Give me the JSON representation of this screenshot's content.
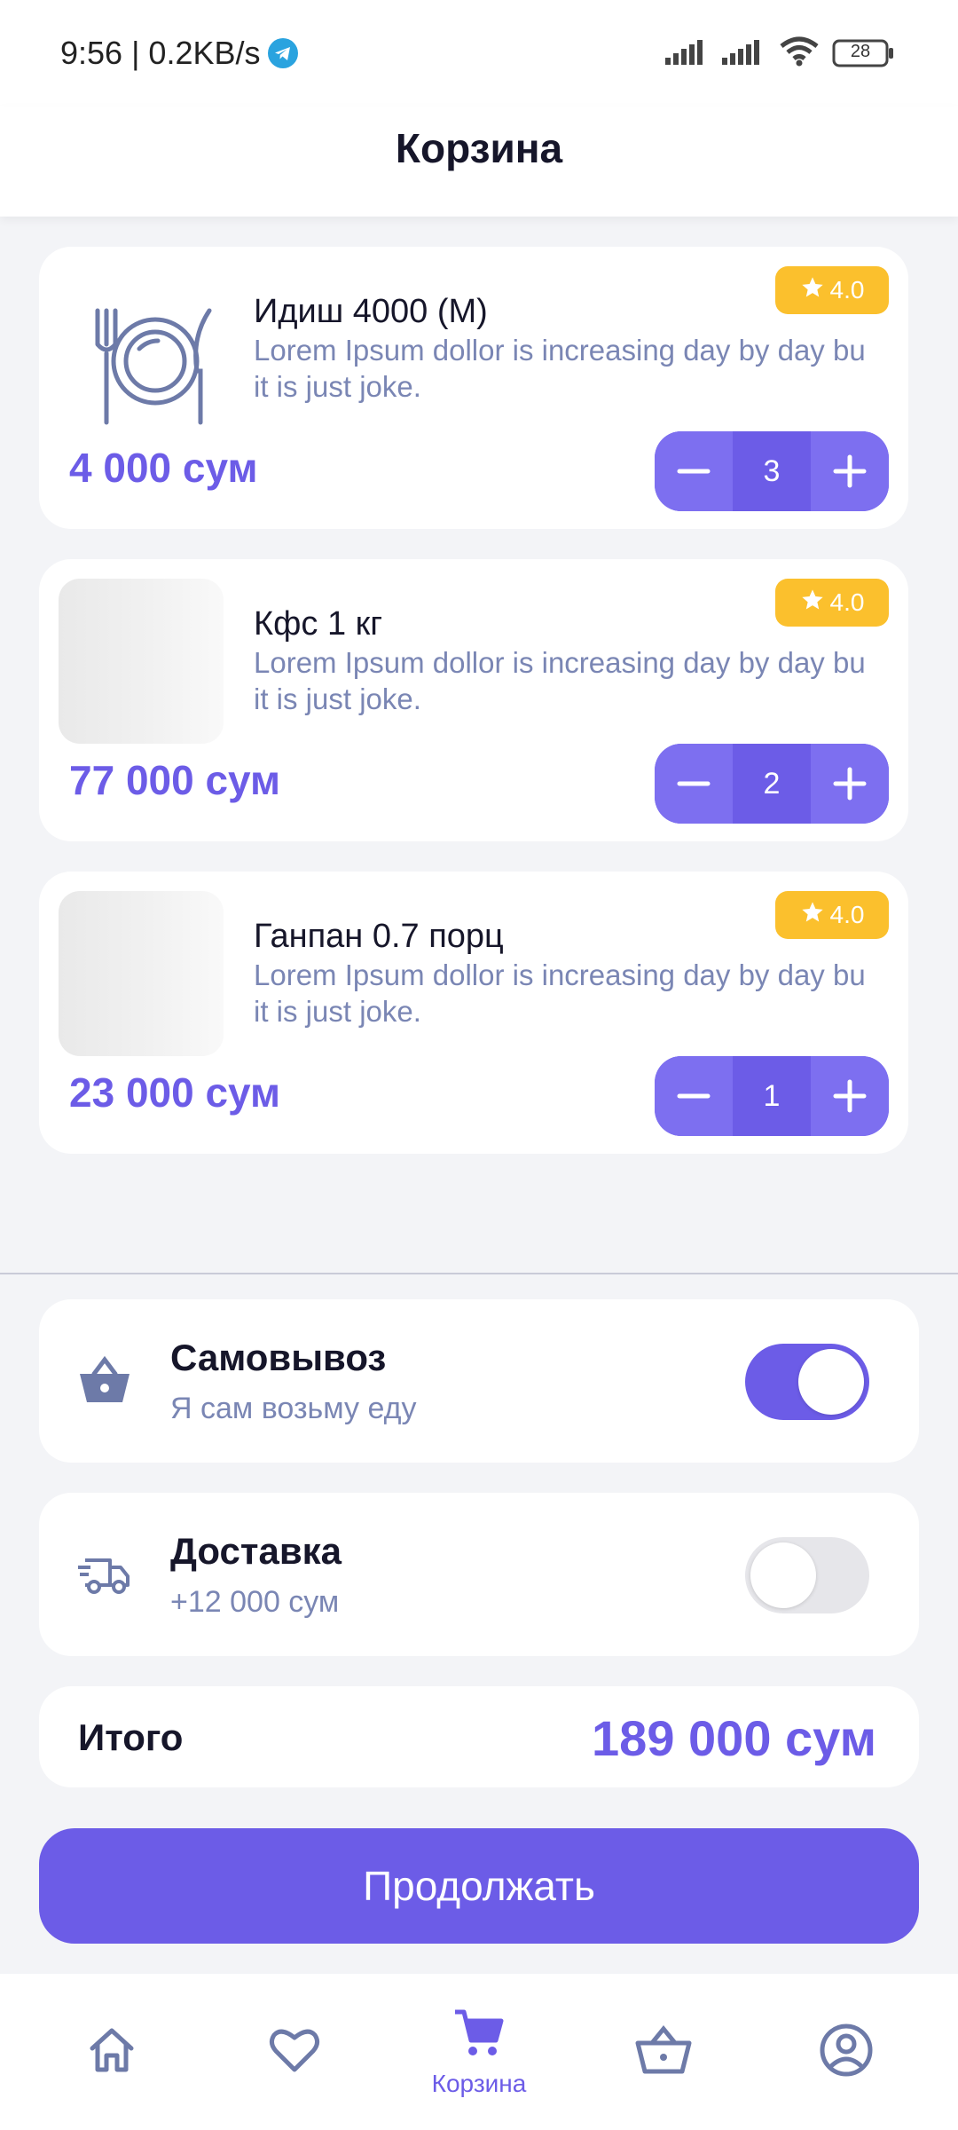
{
  "status_bar": {
    "time_and_speed": "9:56 | 0.2KB/s",
    "battery_level": "28",
    "icons": [
      "telegram-icon",
      "signal-icon",
      "signal-icon",
      "wifi-icon",
      "battery-icon"
    ]
  },
  "header": {
    "title": "Корзина"
  },
  "cart": {
    "items": [
      {
        "name": "Идиш 4000 (М)",
        "description": "Lorem Ipsum dollor is increasing day by day bu it is just joke.",
        "rating": "4.0",
        "price": "4 000 сум",
        "quantity": "3",
        "image": "plate-cutlery-icon"
      },
      {
        "name": "Кфс 1 кг",
        "description": "Lorem Ipsum dollor is increasing day by day bu it is just joke.",
        "rating": "4.0",
        "price": "77 000 сум",
        "quantity": "2",
        "image": "placeholder"
      },
      {
        "name": "Ганпан 0.7 порц",
        "description": "Lorem Ipsum dollor is increasing day by day bu it is just joke.",
        "rating": "4.0",
        "price": "23 000 сум",
        "quantity": "1",
        "image": "placeholder"
      }
    ]
  },
  "delivery_options": {
    "pickup": {
      "title": "Самовывоз",
      "subtitle": "Я сам возьму еду",
      "enabled": true,
      "icon": "basket-icon"
    },
    "delivery": {
      "title": "Доставка",
      "subtitle": "+12 000 сум",
      "enabled": false,
      "icon": "truck-icon"
    }
  },
  "total": {
    "label": "Итого",
    "value": "189 000 сум"
  },
  "continue_label": "Продолжать",
  "bottom_nav": {
    "items": [
      {
        "icon": "home-icon",
        "label": ""
      },
      {
        "icon": "heart-icon",
        "label": ""
      },
      {
        "icon": "cart-icon",
        "label": "Корзина",
        "active": true
      },
      {
        "icon": "basket-icon",
        "label": ""
      },
      {
        "icon": "profile-icon",
        "label": ""
      }
    ]
  },
  "colors": {
    "accent": "#6c5ce7",
    "rating_badge": "#fbc02d",
    "secondary_text": "#7a86b4",
    "background": "#f3f4f7"
  }
}
